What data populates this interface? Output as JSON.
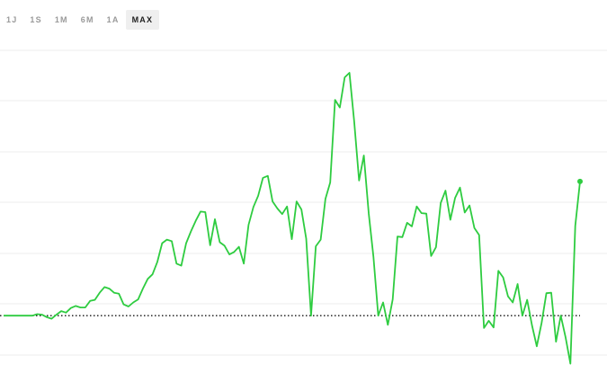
{
  "tabs": [
    {
      "label": "1J",
      "active": false
    },
    {
      "label": "1S",
      "active": false
    },
    {
      "label": "1M",
      "active": false
    },
    {
      "label": "6M",
      "active": false
    },
    {
      "label": "1A",
      "active": false
    },
    {
      "label": "MAX",
      "active": true
    }
  ],
  "colors": {
    "line": "#2ecc40",
    "grid": "#ececec",
    "baseline": "#111111"
  },
  "chart_data": {
    "type": "line",
    "title": "",
    "xlabel": "",
    "ylabel": "",
    "grid": "horizontal",
    "baseline": 0,
    "ylim": [
      -10,
      52
    ],
    "series": [
      {
        "values": [
          0,
          0,
          0,
          0,
          0,
          0,
          0,
          0.3,
          0.2,
          -0.3,
          -0.6,
          0.2,
          0.9,
          0.6,
          1.5,
          1.9,
          1.6,
          1.6,
          2.9,
          3.1,
          4.5,
          5.6,
          5.3,
          4.5,
          4.3,
          2.2,
          1.8,
          2.6,
          3.2,
          5.3,
          7.2,
          8.1,
          10.5,
          14.2,
          14.9,
          14.6,
          10.2,
          9.8,
          14.2,
          16.5,
          18.6,
          20.4,
          20.3,
          13.8,
          18.9,
          14.4,
          13.7,
          12.0,
          12.5,
          13.5,
          10.2,
          17.8,
          21.3,
          23.5,
          27.0,
          27.4,
          22.4,
          21.0,
          19.9,
          21.4,
          15.0,
          22.4,
          20.8,
          15.1,
          0,
          13.6,
          14.9,
          22.9,
          26.1,
          42.3,
          40.8,
          46.7,
          47.6,
          38.0,
          26.5,
          31.4,
          20.1,
          11.5,
          0,
          2.6,
          -1.8,
          3.2,
          15.5,
          15.4,
          18.2,
          17.5,
          21.4,
          20.1,
          20.0,
          11.7,
          13.4,
          22.1,
          24.5,
          18.8,
          23.1,
          25.1,
          20.2,
          21.6,
          17.2,
          15.8,
          -2.4,
          -1.0,
          -2.3,
          8.8,
          7.5,
          3.8,
          2.6,
          6.2,
          0,
          3.1,
          -1.9,
          -6.0,
          -1.4,
          4.4,
          4.5,
          -5.1,
          0,
          -4.3,
          -9.4,
          17.6,
          26.3
        ]
      }
    ]
  }
}
